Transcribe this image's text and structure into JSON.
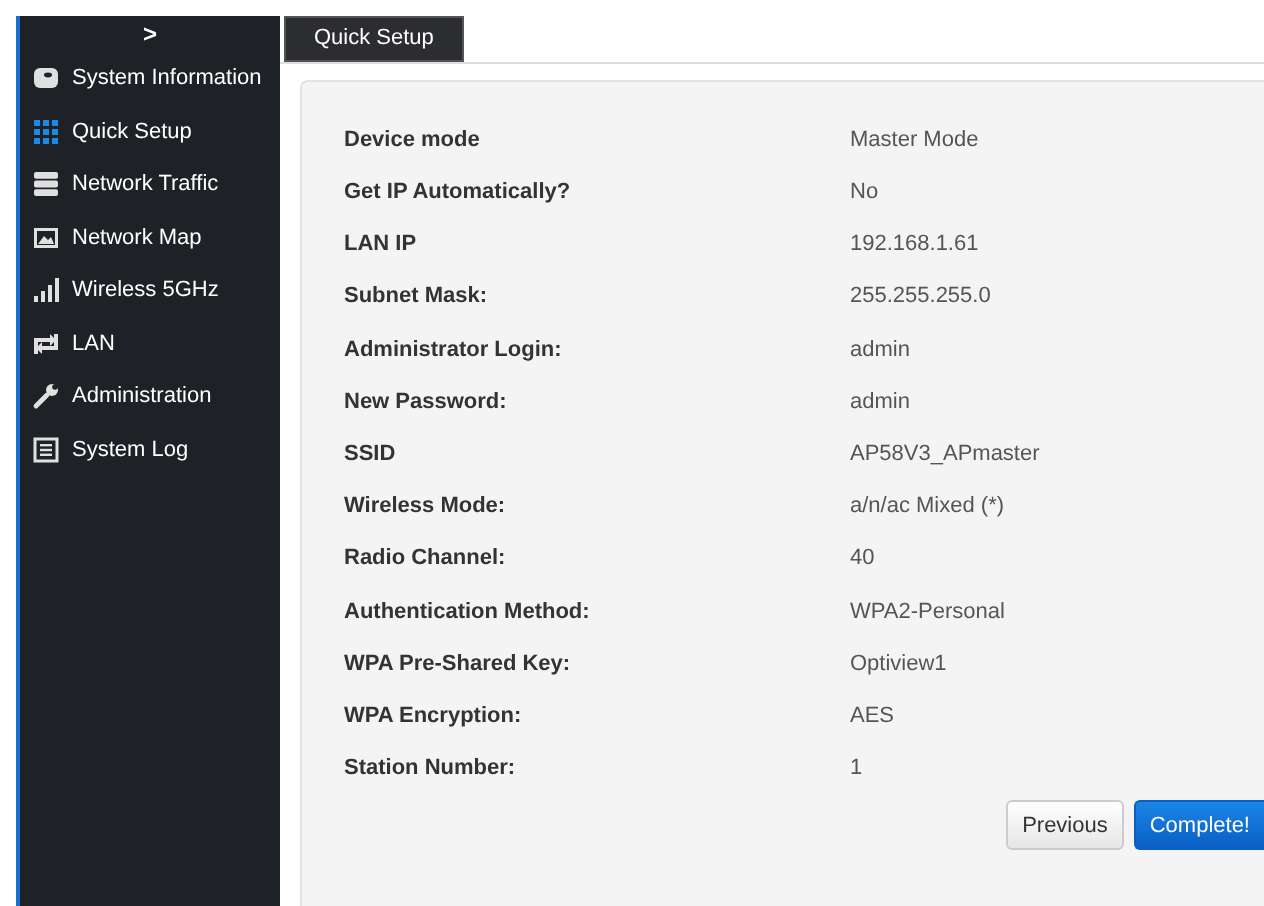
{
  "sidebar": {
    "toggle": ">",
    "items": [
      {
        "label": "System Information",
        "selected": false
      },
      {
        "label": "Quick Setup",
        "selected": true
      },
      {
        "label": "Network Traffic",
        "selected": false
      },
      {
        "label": "Network Map",
        "selected": false
      },
      {
        "label": "Wireless 5GHz",
        "selected": false
      },
      {
        "label": "LAN",
        "selected": false
      },
      {
        "label": "Administration",
        "selected": false
      },
      {
        "label": "System Log",
        "selected": false
      }
    ]
  },
  "tabs": [
    {
      "label": "Quick Setup",
      "selected": true
    }
  ],
  "summary": [
    {
      "label": "Device mode",
      "value": "Master Mode"
    },
    {
      "label": "Get IP Automatically?",
      "value": "No"
    },
    {
      "label": "LAN IP",
      "value": "192.168.1.61"
    },
    {
      "label": "Subnet Mask:",
      "value": "255.255.255.0"
    },
    {
      "label": "Administrator Login:",
      "value": "admin"
    },
    {
      "label": "New Password:",
      "value": "admin"
    },
    {
      "label": "SSID",
      "value": "AP58V3_APmaster"
    },
    {
      "label": "Wireless Mode:",
      "value": "a/n/ac Mixed (*)"
    },
    {
      "label": "Radio Channel:",
      "value": "40"
    },
    {
      "label": "Authentication Method:",
      "value": "WPA2-Personal"
    },
    {
      "label": "WPA Pre-Shared Key:",
      "value": "Optiview1"
    },
    {
      "label": "WPA Encryption:",
      "value": "AES"
    },
    {
      "label": "Station Number:",
      "value": "1"
    }
  ],
  "buttons": [
    {
      "label": "Previous",
      "kind": "secondary"
    },
    {
      "label": "Complete!",
      "kind": "primary"
    }
  ]
}
